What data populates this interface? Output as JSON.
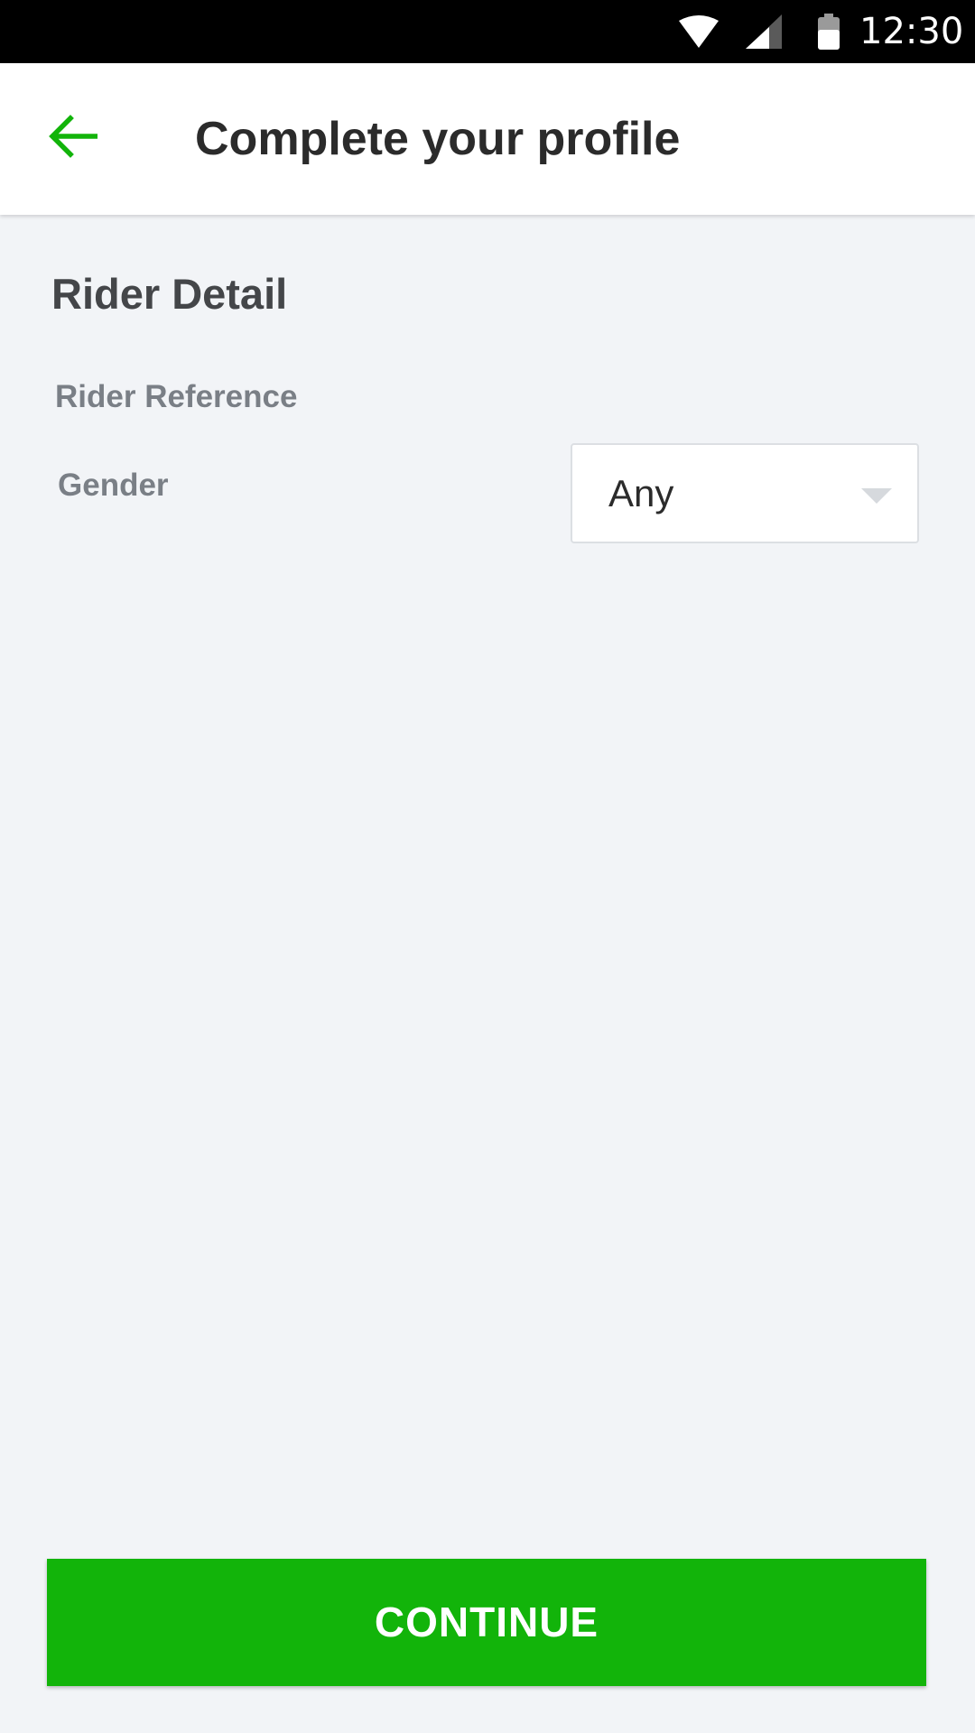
{
  "status_bar": {
    "time": "12:30",
    "icons": [
      "wifi-icon",
      "cellular-signal-icon",
      "battery-icon"
    ]
  },
  "app_bar": {
    "back_icon": "arrow-left-icon",
    "title": "Complete your profile"
  },
  "main": {
    "section_title": "Rider Detail",
    "rider_reference_label": "Rider Reference",
    "gender_label": "Gender",
    "gender_select": {
      "value": "Any",
      "icon": "chevron-down-icon"
    }
  },
  "footer": {
    "continue_label": "CONTINUE"
  },
  "colors": {
    "accent": "#12b40a",
    "background": "#f2f4f7",
    "title_text": "#2b2b2b",
    "label_text": "#7a7f86"
  }
}
